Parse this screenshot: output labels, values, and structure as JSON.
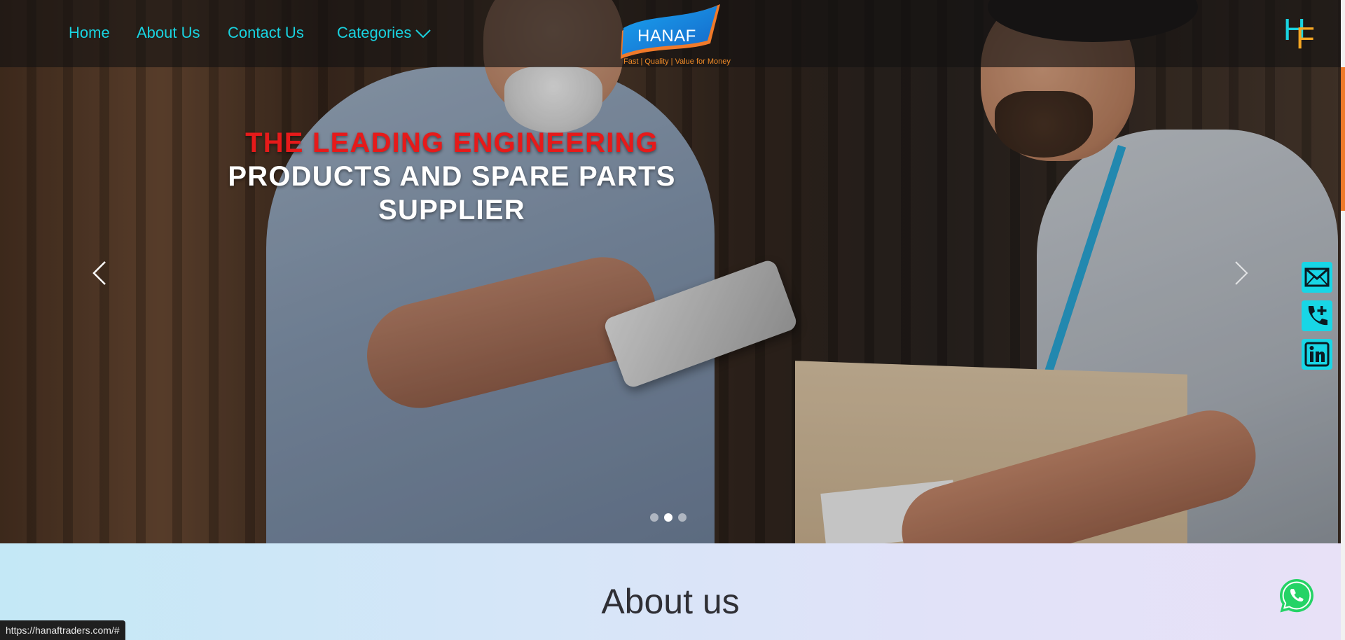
{
  "nav": {
    "home": "Home",
    "about": "About Us",
    "contact": "Contact Us",
    "categories": "Categories"
  },
  "brand": {
    "name": "HANAF",
    "tagline": "Fast | Quality | Value for Money",
    "monogram_h": "H",
    "monogram_f": "F"
  },
  "hero": {
    "line1": "THE LEADING ENGINEERING",
    "line2": "PRODUCTS AND SPARE PARTS",
    "line3": "SUPPLIER",
    "slides_total": 3,
    "active_slide": 2
  },
  "about": {
    "title": "About us"
  },
  "status_bar": {
    "url": "https://hanaftraders.com/#"
  },
  "icons": {
    "prev": "chevron-left-icon",
    "next": "chevron-right-icon",
    "categories_toggle": "chevron-down-icon",
    "mail": "mail-icon",
    "phone": "phone-plus-icon",
    "linkedin": "linkedin-icon",
    "whatsapp": "whatsapp-icon"
  },
  "colors": {
    "nav_link": "#19d3e0",
    "headline_red": "#e61a1a",
    "accent_orange": "#f07a2a",
    "social_bg": "#18d6e6",
    "whatsapp_green": "#25d366"
  }
}
